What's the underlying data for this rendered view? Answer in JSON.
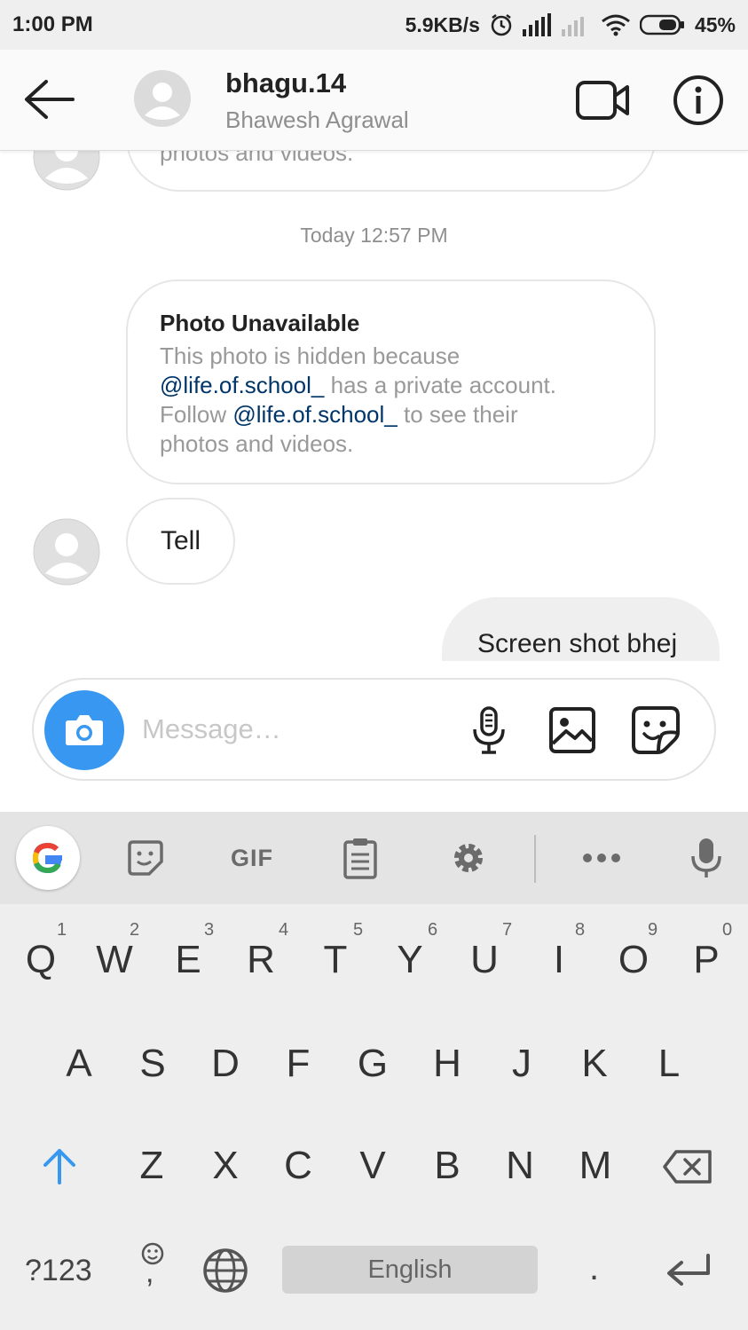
{
  "status_bar": {
    "time": "1:00 PM",
    "speed": "5.9KB/s",
    "battery": "45%"
  },
  "header": {
    "username": "bhagu.14",
    "fullname": "Bhawesh Agrawal",
    "icons": [
      "back-arrow-icon",
      "video-call-icon",
      "info-icon"
    ]
  },
  "chat": {
    "previous_message_fragment": "photos and videos.",
    "timestamp": "Today 12:57 PM",
    "shared_post": {
      "title": "Photo Unavailable",
      "line1": "This photo is hidden because",
      "mention1": "@life.of.school_",
      "line2_rest": " has a private account.",
      "line3_start": "Follow ",
      "mention2": "@life.of.school_",
      "line3_rest": " to see their",
      "line4": "photos and videos."
    },
    "received_message": "Tell",
    "sent_message": "Screen shot bhej"
  },
  "composer": {
    "placeholder": "Message…",
    "icons": [
      "camera-icon",
      "microphone-icon",
      "gallery-icon",
      "sticker-icon"
    ]
  },
  "keyboard": {
    "toolbar_icons": [
      "google-icon",
      "sticker-icon",
      "gif-icon",
      "clipboard-icon",
      "settings-icon",
      "more-icon",
      "mic-icon"
    ],
    "gif_label": "GIF",
    "row1": [
      "Q",
      "W",
      "E",
      "R",
      "T",
      "Y",
      "U",
      "I",
      "O",
      "P"
    ],
    "row1_hints": [
      "1",
      "2",
      "3",
      "4",
      "5",
      "6",
      "7",
      "8",
      "9",
      "0"
    ],
    "row2": [
      "A",
      "S",
      "D",
      "F",
      "G",
      "H",
      "J",
      "K",
      "L"
    ],
    "row3": [
      "Z",
      "X",
      "C",
      "V",
      "B",
      "N",
      "M"
    ],
    "symbols_key": "?123",
    "comma_key": ",",
    "space_label": "English",
    "period_key": ".",
    "accent_color": "#3897f0"
  }
}
